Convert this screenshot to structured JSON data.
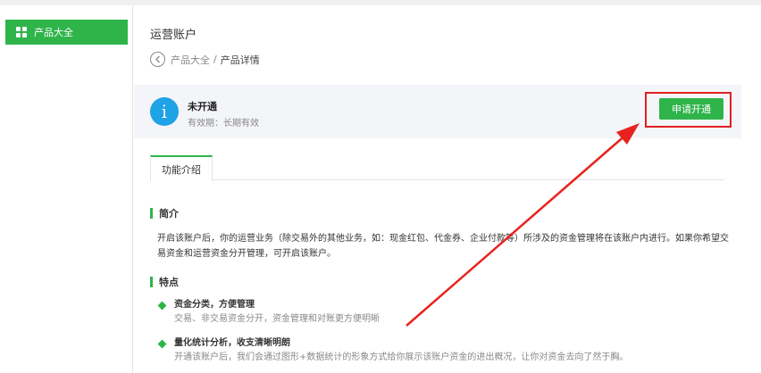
{
  "sidebar": {
    "items": [
      {
        "label": "产品大全",
        "icon": "grid-icon",
        "active": true
      }
    ]
  },
  "header": {
    "title": "运营账户"
  },
  "breadcrumb": {
    "parent": "产品大全",
    "separator": "/",
    "current": "产品详情"
  },
  "status": {
    "icon": "info-icon",
    "title": "未开通",
    "validity": "有效期：长期有效",
    "button_label": "申请开通"
  },
  "tabs": [
    {
      "label": "功能介绍",
      "active": true
    }
  ],
  "sections": {
    "intro_heading": "简介",
    "intro_text": "开启该账户后，你的运营业务（除交易外的其他业务，如：现金红包、代金券、企业付款等）所涉及的资金管理将在该账户内进行。如果你希望交易资金和运营资金分开管理，可开启该账户。",
    "features_heading": "特点",
    "features": [
      {
        "title": "资金分类，方便管理",
        "desc": "交易、非交易资金分开，资金管理和对账更方便明晰"
      },
      {
        "title": "量化统计分析，收支清晰明朗",
        "desc": "开通该账户后，我们会通过图形+数据统计的形象方式给你展示该账户资金的进出概况，让你对资金去向了然于胸。"
      }
    ]
  },
  "colors": {
    "accent": "#2fb44a",
    "info": "#1fa2e6",
    "annotation": "#e02020"
  }
}
